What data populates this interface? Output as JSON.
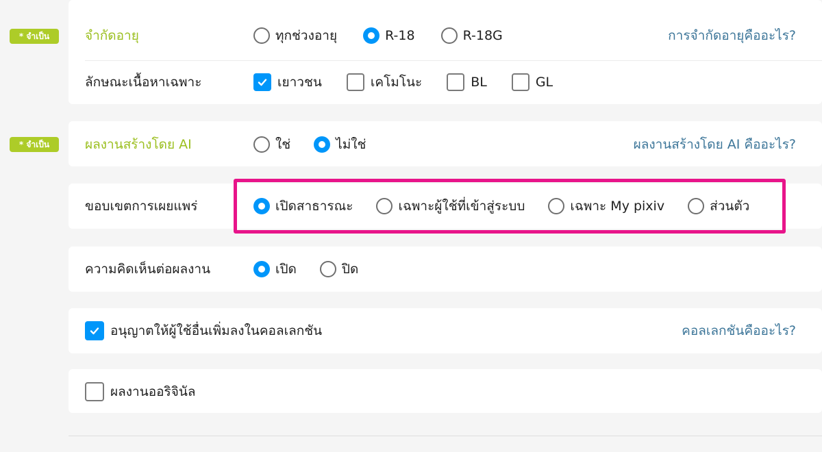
{
  "badge_required": "* จำเป็น",
  "colors": {
    "accent": "#0096fa",
    "required": "#adcc28",
    "link": "#3d7699",
    "highlight": "#e8148a"
  },
  "age_restriction": {
    "label": "จำกัดอายุ",
    "options": [
      "ทุกช่วงอายุ",
      "R-18",
      "R-18G"
    ],
    "selected": "R-18",
    "help": "การจำกัดอายุคืออะไร?"
  },
  "specific_content": {
    "label": "ลักษณะเนื้อหาเฉพาะ",
    "options": [
      {
        "label": "เยาวชน",
        "checked": true
      },
      {
        "label": "เคโมโนะ",
        "checked": false
      },
      {
        "label": "BL",
        "checked": false
      },
      {
        "label": "GL",
        "checked": false
      }
    ]
  },
  "ai_generated": {
    "label": "ผลงานสร้างโดย AI",
    "options": [
      "ใช่",
      "ไม่ใช่"
    ],
    "selected": "ไม่ใช่",
    "help": "ผลงานสร้างโดย AI คืออะไร?"
  },
  "visibility": {
    "label": "ขอบเขตการเผยแพร่",
    "options": [
      "เปิดสาธารณะ",
      "เฉพาะผู้ใช้ที่เข้าสู่ระบบ",
      "เฉพาะ My pixiv",
      "ส่วนตัว"
    ],
    "selected": "เปิดสาธารณะ"
  },
  "comments": {
    "label": "ความคิดเห็นต่อผลงาน",
    "options": [
      "เปิด",
      "ปิด"
    ],
    "selected": "เปิด"
  },
  "collections": {
    "label": "อนุญาตให้ผู้ใช้อื่นเพิ่มลงในคอลเลกชัน",
    "checked": true,
    "help": "คอลเลกชันคืออะไร?"
  },
  "original_work": {
    "label": "ผลงานออริจินัล",
    "checked": false
  }
}
